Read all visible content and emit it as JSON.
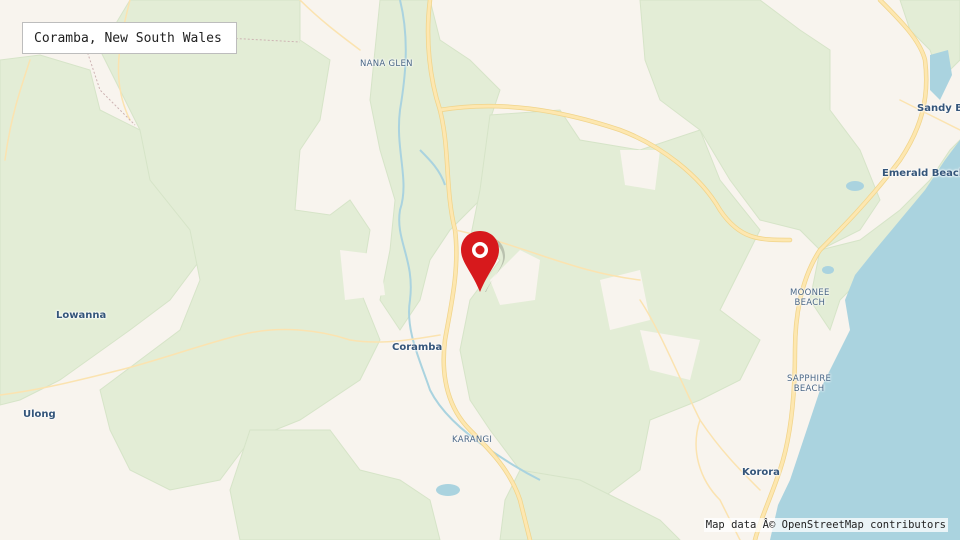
{
  "header": {
    "title": "Coramba, New South Wales"
  },
  "map": {
    "colors": {
      "land": "#f8f4ee",
      "forest": "#e3edd6",
      "forest_border": "#d3e2c4",
      "water": "#aad3df",
      "road": "#fde5a8",
      "road_casing": "#f5d68b",
      "boundary": "#cdb3b3",
      "marker": "#d7191c",
      "label": "#3d5a78"
    },
    "place_labels": [
      {
        "name": "NANA GLEN",
        "type": "locality"
      },
      {
        "name": "Sandy Bea",
        "type": "town"
      },
      {
        "name": "Emerald Beach",
        "type": "town"
      },
      {
        "name": "Lowanna",
        "type": "town"
      },
      {
        "name": "MOONEE BEACH",
        "type": "suburb",
        "line1": "MOONEE",
        "line2": "BEACH"
      },
      {
        "name": "Coramba",
        "type": "town"
      },
      {
        "name": "SAPPHIRE BEACH",
        "type": "suburb",
        "line1": "SAPPHIRE",
        "line2": "BEACH"
      },
      {
        "name": "Ulong",
        "type": "town"
      },
      {
        "name": "KARANGI",
        "type": "locality"
      },
      {
        "name": "Korora",
        "type": "town"
      }
    ],
    "marker": {
      "icon": "map-pin-icon",
      "color": "#d7191c"
    }
  },
  "attribution": {
    "text": "Map data Â© OpenStreetMap contributors"
  }
}
